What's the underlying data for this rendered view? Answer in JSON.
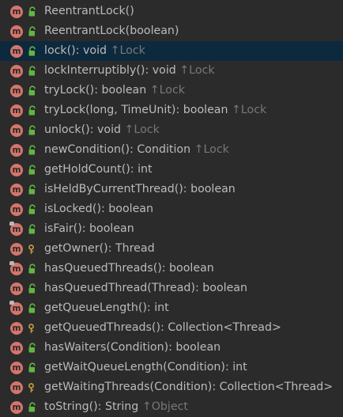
{
  "colors": {
    "background": "#2b2b2b",
    "selected_row": "#0d293e",
    "method_icon": "#d5756c",
    "public_lock": "#62b543",
    "protected_key": "#c7a13f",
    "text": "#bbbbbb",
    "owner_text": "#787878"
  },
  "members": [
    {
      "name": "ReentrantLock()",
      "ret": "",
      "owner": "",
      "vis": "public",
      "icon": "method",
      "overridden": false,
      "selected": false
    },
    {
      "name": "ReentrantLock(boolean)",
      "ret": "",
      "owner": "",
      "vis": "public",
      "icon": "method",
      "overridden": false,
      "selected": false
    },
    {
      "name": "lock()",
      "ret": ": void",
      "owner": "↑Lock",
      "vis": "public",
      "icon": "method",
      "overridden": false,
      "selected": true
    },
    {
      "name": "lockInterruptibly()",
      "ret": ": void",
      "owner": "↑Lock",
      "vis": "public",
      "icon": "method",
      "overridden": false,
      "selected": false
    },
    {
      "name": "tryLock()",
      "ret": ": boolean",
      "owner": "↑Lock",
      "vis": "public",
      "icon": "method",
      "overridden": false,
      "selected": false
    },
    {
      "name": "tryLock(long, TimeUnit)",
      "ret": ": boolean",
      "owner": "↑Lock",
      "vis": "public",
      "icon": "method",
      "overridden": false,
      "selected": false
    },
    {
      "name": "unlock()",
      "ret": ": void",
      "owner": "↑Lock",
      "vis": "public",
      "icon": "method",
      "overridden": false,
      "selected": false
    },
    {
      "name": "newCondition()",
      "ret": ": Condition",
      "owner": "↑Lock",
      "vis": "public",
      "icon": "method",
      "overridden": false,
      "selected": false
    },
    {
      "name": "getHoldCount()",
      "ret": ": int",
      "owner": "",
      "vis": "public",
      "icon": "method",
      "overridden": false,
      "selected": false
    },
    {
      "name": "isHeldByCurrentThread()",
      "ret": ": boolean",
      "owner": "",
      "vis": "public",
      "icon": "method",
      "overridden": false,
      "selected": false
    },
    {
      "name": "isLocked()",
      "ret": ": boolean",
      "owner": "",
      "vis": "public",
      "icon": "method",
      "overridden": false,
      "selected": false
    },
    {
      "name": "isFair()",
      "ret": ": boolean",
      "owner": "",
      "vis": "public",
      "icon": "method",
      "overridden": true,
      "selected": false
    },
    {
      "name": "getOwner()",
      "ret": ": Thread",
      "owner": "",
      "vis": "protected",
      "icon": "method",
      "overridden": false,
      "selected": false
    },
    {
      "name": "hasQueuedThreads()",
      "ret": ": boolean",
      "owner": "",
      "vis": "public",
      "icon": "method",
      "overridden": true,
      "selected": false
    },
    {
      "name": "hasQueuedThread(Thread)",
      "ret": ": boolean",
      "owner": "",
      "vis": "public",
      "icon": "method",
      "overridden": false,
      "selected": false
    },
    {
      "name": "getQueueLength()",
      "ret": ": int",
      "owner": "",
      "vis": "public",
      "icon": "method",
      "overridden": true,
      "selected": false
    },
    {
      "name": "getQueuedThreads()",
      "ret": ": Collection<Thread>",
      "owner": "",
      "vis": "protected",
      "icon": "method",
      "overridden": false,
      "selected": false
    },
    {
      "name": "hasWaiters(Condition)",
      "ret": ": boolean",
      "owner": "",
      "vis": "public",
      "icon": "method",
      "overridden": false,
      "selected": false
    },
    {
      "name": "getWaitQueueLength(Condition)",
      "ret": ": int",
      "owner": "",
      "vis": "public",
      "icon": "method",
      "overridden": false,
      "selected": false
    },
    {
      "name": "getWaitingThreads(Condition)",
      "ret": ": Collection<Thread>",
      "owner": "",
      "vis": "protected",
      "icon": "method",
      "overridden": false,
      "selected": false
    },
    {
      "name": "toString()",
      "ret": ": String",
      "owner": "↑Object",
      "vis": "public",
      "icon": "method",
      "overridden": false,
      "selected": false
    }
  ]
}
